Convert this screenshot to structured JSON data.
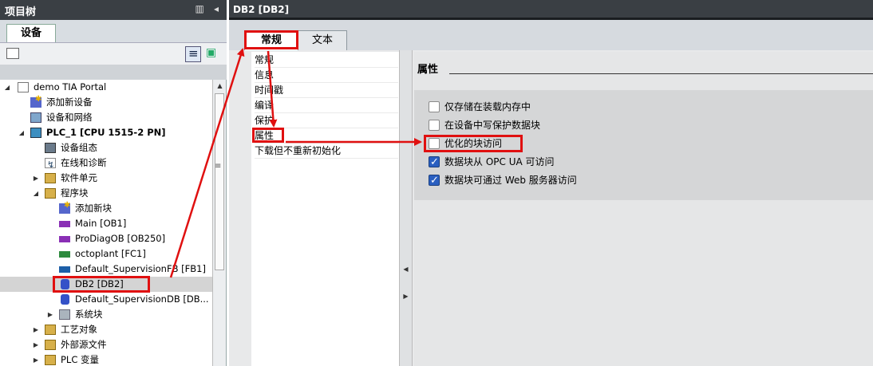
{
  "tree": {
    "header_title": "项目树",
    "header_icons": "▥ ◂",
    "tab_label": "设备",
    "items": [
      {
        "label": "demo TIA Portal"
      },
      {
        "label": "添加新设备"
      },
      {
        "label": "设备和网络"
      },
      {
        "label": "PLC_1 [CPU 1515-2 PN]"
      },
      {
        "label": "设备组态"
      },
      {
        "label": "在线和诊断"
      },
      {
        "label": "软件单元"
      },
      {
        "label": "程序块"
      },
      {
        "label": "添加新块"
      },
      {
        "label": "Main [OB1]"
      },
      {
        "label": "ProDiagOB [OB250]"
      },
      {
        "label": "octoplant [FC1]"
      },
      {
        "label": "Default_SupervisionFB [FB1]"
      },
      {
        "label": "DB2 [DB2]"
      },
      {
        "label": "Default_SupervisionDB [DB..."
      },
      {
        "label": "系统块"
      },
      {
        "label": "工艺对象"
      },
      {
        "label": "外部源文件"
      },
      {
        "label": "PLC 变量"
      }
    ]
  },
  "editor": {
    "title": "DB2 [DB2]",
    "tabs": [
      {
        "label": "常规"
      },
      {
        "label": "文本"
      }
    ],
    "nav": [
      {
        "label": "常规"
      },
      {
        "label": "信息"
      },
      {
        "label": "时间戳"
      },
      {
        "label": "编译"
      },
      {
        "label": "保护"
      },
      {
        "label": "属性"
      },
      {
        "label": "下载但不重新初始化"
      }
    ],
    "props_title": "属性",
    "options": [
      {
        "label": "仅存储在装载内存中",
        "checked": false
      },
      {
        "label": "在设备中写保护数据块",
        "checked": false
      },
      {
        "label": "优化的块访问",
        "checked": false
      },
      {
        "label": "数据块从 OPC UA 可访问",
        "checked": true
      },
      {
        "label": "数据块可通过 Web 服务器访问",
        "checked": true
      }
    ]
  },
  "annotation_color": "#e01010"
}
